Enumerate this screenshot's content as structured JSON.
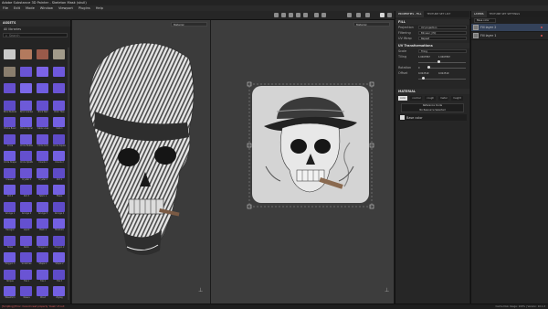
{
  "app": {
    "title": "Adobe Substance 3D Painter - Skeleton Mask (skull)"
  },
  "menu": [
    "File",
    "Edit",
    "Mode",
    "Window",
    "Viewport",
    "Plugins",
    "Help"
  ],
  "assets": {
    "panel_title": "ASSETS",
    "library": "All libraries",
    "search_placeholder": "Search",
    "tiles": [
      {
        "label": "",
        "color": "#c9c9c9"
      },
      {
        "label": "",
        "color": "#b37a5e"
      },
      {
        "label": "",
        "color": "#9a5a4a"
      },
      {
        "label": "",
        "color": "#a19a8a"
      },
      {
        "label": "",
        "color": "#8a7e6e"
      },
      {
        "label": "",
        "color": "#6a54d4"
      },
      {
        "label": "",
        "color": "#7c63e6"
      },
      {
        "label": "",
        "color": "#6e58dc"
      },
      {
        "label": "",
        "color": "#6650d0"
      },
      {
        "label": "",
        "color": "#7b68e8"
      },
      {
        "label": "",
        "color": "#6f5de0"
      },
      {
        "label": "",
        "color": "#6a54d4"
      },
      {
        "label": "Brick Bubbles",
        "color": "#5e4bc8"
      },
      {
        "label": "Brick Gradient",
        "color": "#6d5ad8"
      },
      {
        "label": "Brick Wall",
        "color": "#6450cf"
      },
      {
        "label": "Brick Tiles",
        "color": "#6b57d8"
      },
      {
        "label": "Bricks Basic",
        "color": "#6450cf"
      },
      {
        "label": "Bricks Spiral",
        "color": "#6f5de0"
      },
      {
        "label": "Cable Lines",
        "color": "#6a54d4"
      },
      {
        "label": "Cells 1",
        "color": "#7360e2"
      },
      {
        "label": "Circle",
        "color": "#6450cf"
      },
      {
        "label": "Circle Bubbles",
        "color": "#6d5ad8"
      },
      {
        "label": "Circle Grid",
        "color": "#6a54d4"
      },
      {
        "label": "Circle Square",
        "color": "#5e4bc8"
      },
      {
        "label": "Circle Shape",
        "color": "#6f5de0"
      },
      {
        "label": "Circle Splatter",
        "color": "#6450cf"
      },
      {
        "label": "Clouds 1",
        "color": "#6b57d8"
      },
      {
        "label": "Clouds 2",
        "color": "#7360e2"
      },
      {
        "label": "Creased",
        "color": "#6450cf"
      },
      {
        "label": "Crystal 1",
        "color": "#6a54d4"
      },
      {
        "label": "Crystal 2",
        "color": "#6d5ad8"
      },
      {
        "label": "Dirt 1",
        "color": "#5e4bc8"
      },
      {
        "label": "Dirt 2",
        "color": "#6f5de0"
      },
      {
        "label": "Dirt 3",
        "color": "#6450cf"
      },
      {
        "label": "Fabric 1",
        "color": "#6b57d8"
      },
      {
        "label": "Fibers",
        "color": "#7360e2"
      },
      {
        "label": "Grunge 1",
        "color": "#6450cf"
      },
      {
        "label": "Grunge 2",
        "color": "#6a54d4"
      },
      {
        "label": "Grunge 3",
        "color": "#6d5ad8"
      },
      {
        "label": "Grunge 4",
        "color": "#5e4bc8"
      },
      {
        "label": "Hexagon",
        "color": "#6f5de0"
      },
      {
        "label": "Liquid",
        "color": "#6450cf"
      },
      {
        "label": "Mesh 1",
        "color": "#6b57d8"
      },
      {
        "label": "Moisture",
        "color": "#7360e2"
      },
      {
        "label": "Noise",
        "color": "#6450cf"
      },
      {
        "label": "Perlin",
        "color": "#6a54d4"
      },
      {
        "label": "Polygon 1",
        "color": "#6d5ad8"
      },
      {
        "label": "Polygon 2",
        "color": "#5e4bc8"
      },
      {
        "label": "Polygon 3",
        "color": "#6f5de0"
      },
      {
        "label": "Scratches",
        "color": "#6450cf"
      },
      {
        "label": "Shape 1",
        "color": "#6b57d8"
      },
      {
        "label": "Shape 2",
        "color": "#7360e2"
      },
      {
        "label": "Stripes",
        "color": "#6450cf"
      },
      {
        "label": "Tile 1",
        "color": "#6a54d4"
      },
      {
        "label": "Tile 2",
        "color": "#6d5ad8"
      },
      {
        "label": "Tile 3",
        "color": "#5e4bc8"
      },
      {
        "label": "Waveform",
        "color": "#6f5de0"
      },
      {
        "label": "Weave",
        "color": "#6450cf"
      },
      {
        "label": "Wood",
        "color": "#6b57d8"
      },
      {
        "label": "Zigzag",
        "color": "#7360e2"
      }
    ]
  },
  "viewport3d": {
    "mode": "Material"
  },
  "viewport2d": {
    "mode": "Material"
  },
  "properties": {
    "tabs": [
      "PROPERTIES - FILL",
      "TEXTURE SET LIST"
    ],
    "fill_section": "FILL",
    "rows": [
      {
        "label": "Projection",
        "value": "UV projection"
      },
      {
        "label": "Filtering",
        "value": "Bilinear | HQ"
      },
      {
        "label": "UV Wrap",
        "value": "Repeat"
      }
    ],
    "uv_section": "UV Transformations",
    "scale_label": "Scale",
    "scale_value": "Tiling",
    "tiling_label": "Tiling",
    "tiling_u": "1.0467867",
    "tiling_v": "1.0467867",
    "rotation_label": "Rotation",
    "rotation_value": "0",
    "offset_label": "Offset",
    "offset_u": "0.022519",
    "offset_v": "0.022519",
    "material_section": "MATERIAL",
    "channels": [
      "color",
      "normal",
      "rough",
      "metal",
      "height"
    ],
    "resource_line1": "Reference mode",
    "resource_line2": "No Resource Selected",
    "material_name": "Base color"
  },
  "layers": {
    "tabs": [
      "LAYERS",
      "TEXTURE SET SETTINGS"
    ],
    "blend": "Base color",
    "items": [
      "Fill layer 2",
      "Fill layer 1"
    ]
  },
  "status": {
    "error": "[Scripting] Error: Cannot read property 'mask' of null",
    "right": "Cache Disk Usage: 100% | Version: 10.1.2"
  }
}
